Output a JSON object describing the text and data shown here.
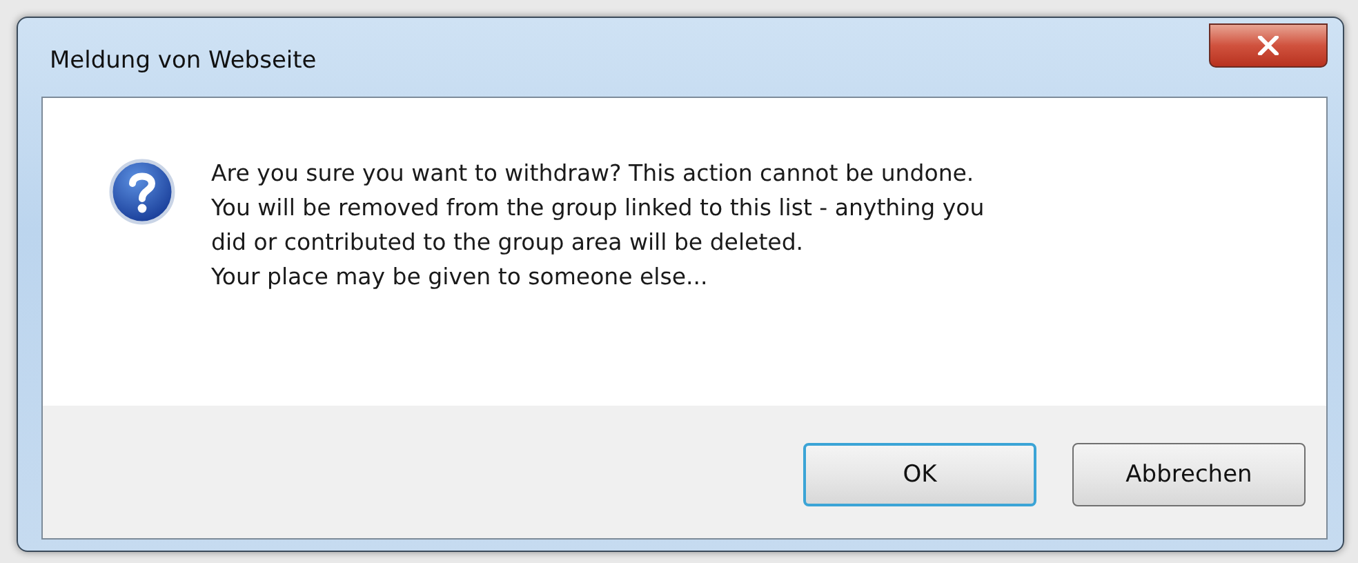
{
  "window": {
    "title": "Meldung von Webseite"
  },
  "message": {
    "lines": [
      "Are you sure you want to withdraw? This action cannot be undone.",
      "You will be removed from the group linked to this list - anything you",
      "did or contributed to the group area will be deleted.",
      "Your place may be given to someone else..."
    ]
  },
  "buttons": [
    {
      "label": "OK",
      "selected": true
    },
    {
      "label": "Abbrechen",
      "selected": false
    }
  ]
}
